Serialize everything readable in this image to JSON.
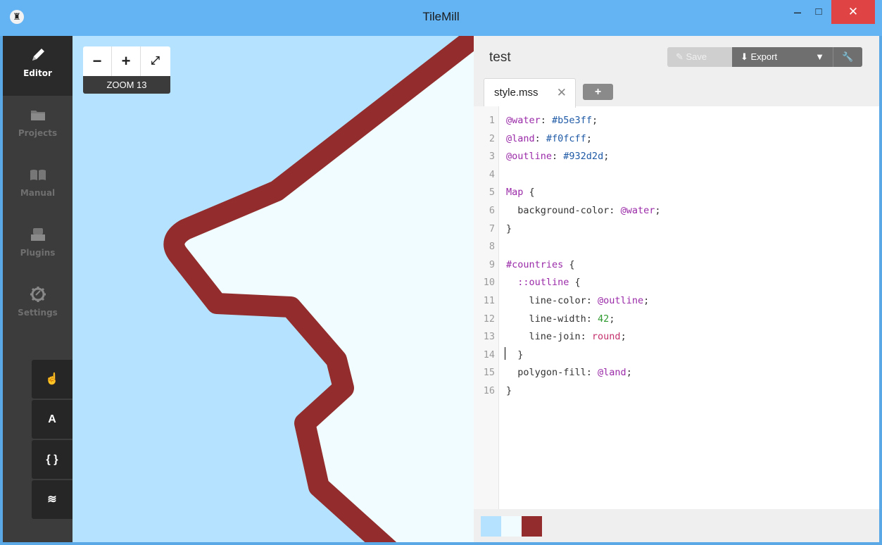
{
  "window": {
    "title": "TileMill",
    "minimize_glyph": "–",
    "maximize_glyph": "□",
    "close_glyph": "✕"
  },
  "sidebar": {
    "items": [
      {
        "label": "Editor",
        "icon": "pencil-icon",
        "active": true
      },
      {
        "label": "Projects",
        "icon": "folder-icon",
        "active": false
      },
      {
        "label": "Manual",
        "icon": "book-icon",
        "active": false
      },
      {
        "label": "Plugins",
        "icon": "plugin-icon",
        "active": false
      },
      {
        "label": "Settings",
        "icon": "gear-icon",
        "active": false
      }
    ],
    "tools": [
      {
        "name": "hand-tool",
        "glyph": "☝"
      },
      {
        "name": "font-tool",
        "glyph": "A"
      },
      {
        "name": "code-tool",
        "glyph": "{ }"
      },
      {
        "name": "layers-tool",
        "glyph": "≋"
      }
    ]
  },
  "map": {
    "zoom_out": "−",
    "zoom_in": "+",
    "fullscreen": "⤢",
    "zoom_label": "ZOOM 13",
    "water_color": "#b5e3ff",
    "land_color": "#f0fcff",
    "outline_color": "#932d2d"
  },
  "editor": {
    "project_title": "test",
    "save_label": "Save",
    "export_label": "Export",
    "tab_label": "style.mss",
    "tab_close": "✕",
    "tab_add": "+"
  },
  "code_lines": [
    {
      "n": "1",
      "text": "@water: #b5e3ff;"
    },
    {
      "n": "2",
      "text": "@land: #f0fcff;"
    },
    {
      "n": "3",
      "text": "@outline: #932d2d;"
    },
    {
      "n": "4",
      "text": ""
    },
    {
      "n": "5",
      "text": "Map {"
    },
    {
      "n": "6",
      "text": "  background-color: @water;"
    },
    {
      "n": "7",
      "text": "}"
    },
    {
      "n": "8",
      "text": ""
    },
    {
      "n": "9",
      "text": "#countries {"
    },
    {
      "n": "10",
      "text": "  ::outline {"
    },
    {
      "n": "11",
      "text": "    line-color: @outline;"
    },
    {
      "n": "12",
      "text": "    line-width: 42;"
    },
    {
      "n": "13",
      "text": "    line-join: round;"
    },
    {
      "n": "14",
      "text": "  }"
    },
    {
      "n": "15",
      "text": "  polygon-fill: @land;"
    },
    {
      "n": "16",
      "text": "}"
    }
  ],
  "swatches": [
    "#b5e3ff",
    "#f0fcff",
    "#932d2d"
  ]
}
